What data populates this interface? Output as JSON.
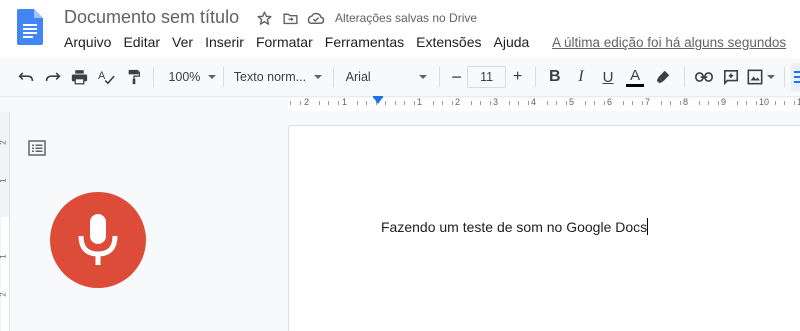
{
  "header": {
    "title": "Documento sem título",
    "saved_status": "Alterações salvas no Drive",
    "last_edit": "A última edição foi há alguns segundos",
    "menu": [
      "Arquivo",
      "Editar",
      "Ver",
      "Inserir",
      "Formatar",
      "Ferramentas",
      "Extensões",
      "Ajuda"
    ],
    "icons": [
      "docs-logo-icon",
      "star-icon",
      "move-folder-icon",
      "cloud-check-icon"
    ]
  },
  "toolbar": {
    "zoom": "100%",
    "style": "Texto norm...",
    "font": "Arial",
    "font_size": "11",
    "minus": "−",
    "plus": "+",
    "bold": "B",
    "italic": "I",
    "underline": "U",
    "text_color": "A",
    "icons": [
      "undo-icon",
      "redo-icon",
      "print-icon",
      "spellcheck-icon",
      "paint-format-icon",
      "highlighter-icon",
      "link-icon",
      "add-comment-icon",
      "insert-image-icon",
      "align-left-icon"
    ]
  },
  "ruler": {
    "labels": [
      "2",
      "1",
      "1",
      "2",
      "3",
      "4",
      "5",
      "6",
      "7",
      "8",
      "9",
      "10",
      "11"
    ],
    "vertical_labels": [
      "2",
      "1",
      "1",
      "2"
    ]
  },
  "document": {
    "text": "Fazendo um teste de som no Google Docs"
  },
  "colors": {
    "accent": "#1a73e8",
    "mic": "#dd4b39",
    "docs_blue": "#4285f4"
  }
}
